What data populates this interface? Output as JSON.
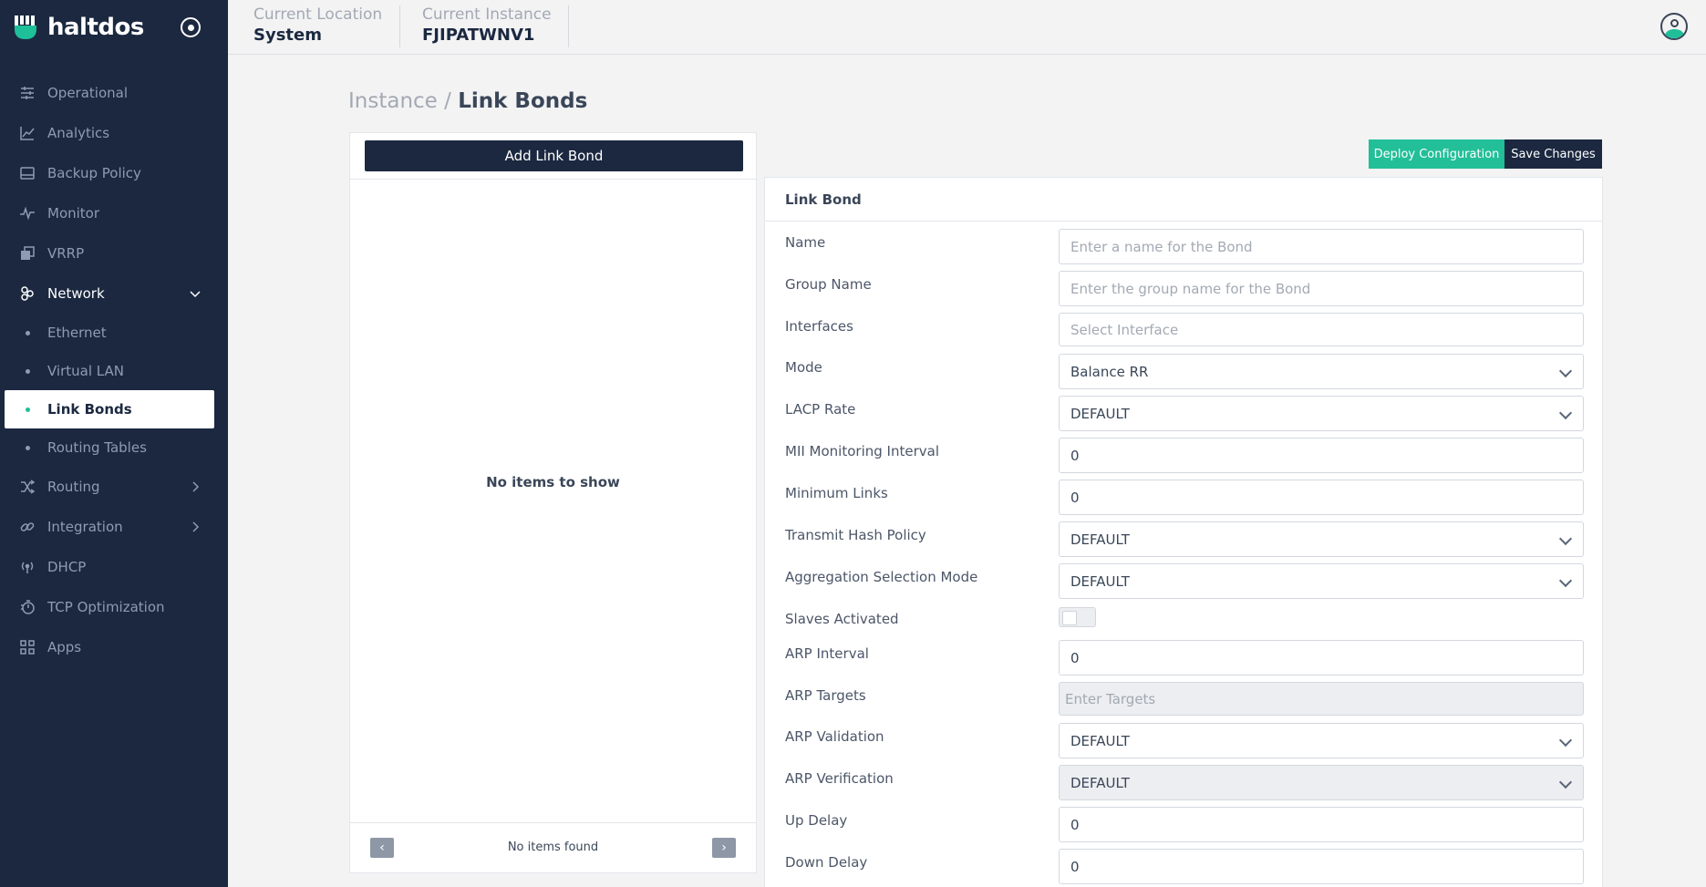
{
  "brand": {
    "name": "haltdos"
  },
  "sidebar": {
    "items": [
      {
        "label": "Operational",
        "icon": "sliders-icon"
      },
      {
        "label": "Analytics",
        "icon": "line-chart-icon"
      },
      {
        "label": "Backup Policy",
        "icon": "hard-drive-icon"
      },
      {
        "label": "Monitor",
        "icon": "pulse-icon"
      },
      {
        "label": "VRRP",
        "icon": "copy-icon"
      },
      {
        "label": "Network",
        "icon": "network-icon",
        "expanded": true
      },
      {
        "label": "Routing",
        "icon": "shuffle-icon"
      },
      {
        "label": "Integration",
        "icon": "link-icon"
      },
      {
        "label": "DHCP",
        "icon": "broadcast-icon"
      },
      {
        "label": "TCP Optimization",
        "icon": "stopwatch-icon"
      },
      {
        "label": "Apps",
        "icon": "grid-icon"
      }
    ],
    "network_sub": [
      {
        "label": "Ethernet"
      },
      {
        "label": "Virtual LAN"
      },
      {
        "label": "Link Bonds",
        "active": true
      },
      {
        "label": "Routing Tables"
      }
    ]
  },
  "topbar": {
    "location_label": "Current Location",
    "location_value": "System",
    "instance_label": "Current Instance",
    "instance_value": "FJIPATWNV1"
  },
  "breadcrumb": {
    "parent": "Instance",
    "separator": "/",
    "current": "Link Bonds"
  },
  "list_panel": {
    "add_button": "Add Link Bond",
    "empty_message": "No items to show",
    "footer_text": "No items found",
    "prev": "‹",
    "next": "›"
  },
  "actions": {
    "deploy": "Deploy Configuration",
    "save": "Save Changes"
  },
  "form": {
    "title": "Link Bond",
    "fields": {
      "name": {
        "label": "Name",
        "placeholder": "Enter a name for the Bond"
      },
      "group_name": {
        "label": "Group Name",
        "placeholder": "Enter the group name for the Bond"
      },
      "interfaces": {
        "label": "Interfaces",
        "placeholder": "Select Interface"
      },
      "mode": {
        "label": "Mode",
        "value": "Balance RR"
      },
      "lacp_rate": {
        "label": "LACP Rate",
        "value": "DEFAULT"
      },
      "mii_interval": {
        "label": "MII Monitoring Interval",
        "value": "0"
      },
      "min_links": {
        "label": "Minimum Links",
        "value": "0"
      },
      "hash_policy": {
        "label": "Transmit Hash Policy",
        "value": "DEFAULT"
      },
      "agg_mode": {
        "label": "Aggregation Selection Mode",
        "value": "DEFAULT"
      },
      "slaves": {
        "label": "Slaves Activated",
        "value": false
      },
      "arp_interval": {
        "label": "ARP Interval",
        "value": "0"
      },
      "arp_targets": {
        "label": "ARP Targets",
        "placeholder": "Enter Targets"
      },
      "arp_validation": {
        "label": "ARP Validation",
        "value": "DEFAULT"
      },
      "arp_verification": {
        "label": "ARP Verification",
        "value": "DEFAULT"
      },
      "up_delay": {
        "label": "Up Delay",
        "value": "0"
      },
      "down_delay": {
        "label": "Down Delay",
        "value": "0"
      }
    }
  },
  "colors": {
    "sidebar": "#1b2840",
    "accent": "#22bf98",
    "dark_button": "#1b2840"
  }
}
